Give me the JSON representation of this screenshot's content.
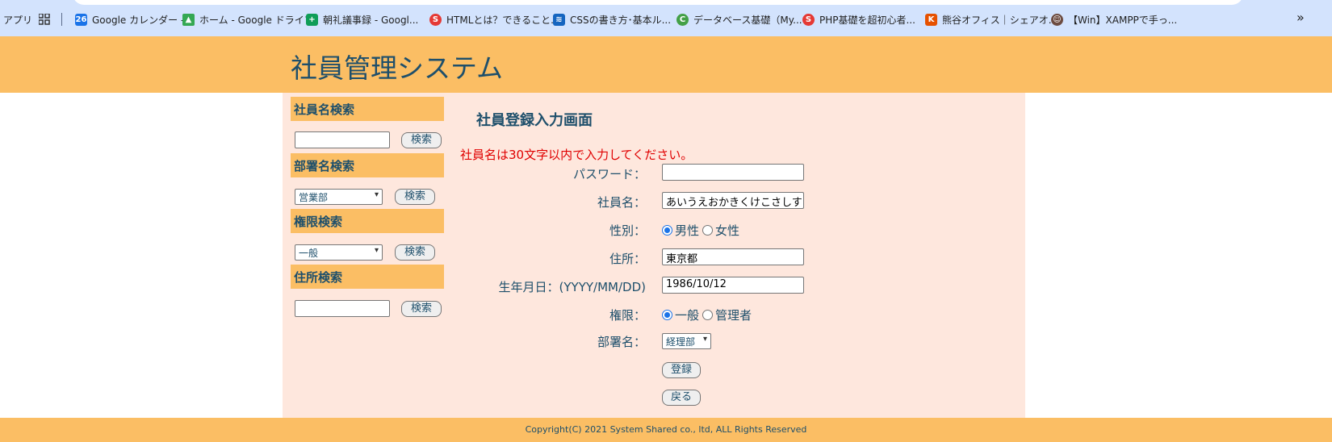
{
  "bookmarks": {
    "apps": "アプリ",
    "items": [
      {
        "label": "Google カレンダー -",
        "icon": "calendar-icon",
        "color": "#1a73e8"
      },
      {
        "label": "ホーム - Google ドライブ",
        "icon": "drive-icon",
        "color": "#34a853"
      },
      {
        "label": "朝礼議事録 - Googl...",
        "icon": "sheets-icon",
        "color": "#0f9d58"
      },
      {
        "label": "HTMLとは？できること...",
        "icon": "site-icon",
        "color": "#e53935"
      },
      {
        "label": "CSSの書き方･基本ル...",
        "icon": "site-icon",
        "color": "#1565c0"
      },
      {
        "label": "データベース基礎（My...",
        "icon": "site-icon",
        "color": "#43a047"
      },
      {
        "label": "PHP基礎を超初心者...",
        "icon": "site-icon",
        "color": "#e53935"
      },
      {
        "label": "熊谷オフィス｜シェアオ...",
        "icon": "site-icon",
        "color": "#e65100"
      },
      {
        "label": "【Win】XAMPPで手っ...",
        "icon": "avatar-icon",
        "color": "#6d4c41"
      }
    ]
  },
  "header": {
    "title": "社員管理システム"
  },
  "sidebar": {
    "name_search": {
      "title": "社員名検索",
      "button": "検索"
    },
    "dept_search": {
      "title": "部署名検索",
      "selected": "営業部",
      "button": "検索"
    },
    "role_search": {
      "title": "権限検索",
      "selected": "一般",
      "button": "検索"
    },
    "address_search": {
      "title": "住所検索",
      "button": "検索"
    }
  },
  "form": {
    "title": "社員登録入力画面",
    "error": "社員名は30文字以内で入力してください。",
    "password_label": "パスワード：",
    "password_value": "",
    "name_label": "社員名：",
    "name_value": "あいうえおかきくけこさしす",
    "gender_label": "性別：",
    "gender_male": "男性",
    "gender_female": "女性",
    "address_label": "住所：",
    "address_value": "東京都",
    "birth_label": "生年月日：(YYYY/MM/DD)",
    "birth_value": "1986/10/12",
    "role_label": "権限：",
    "role_general": "一般",
    "role_admin": "管理者",
    "dept_label": "部署名：",
    "dept_value": "経理部",
    "submit": "登録",
    "back": "戻る"
  },
  "footer": {
    "copyright": "Copyright(C) 2021 System Shared co., ltd, ALL Rights Reserved"
  },
  "colors": {
    "header": "#fbbe64",
    "main_bg": "#fee7dd",
    "title_text": "#1e4f6b",
    "error": "#e00000"
  }
}
